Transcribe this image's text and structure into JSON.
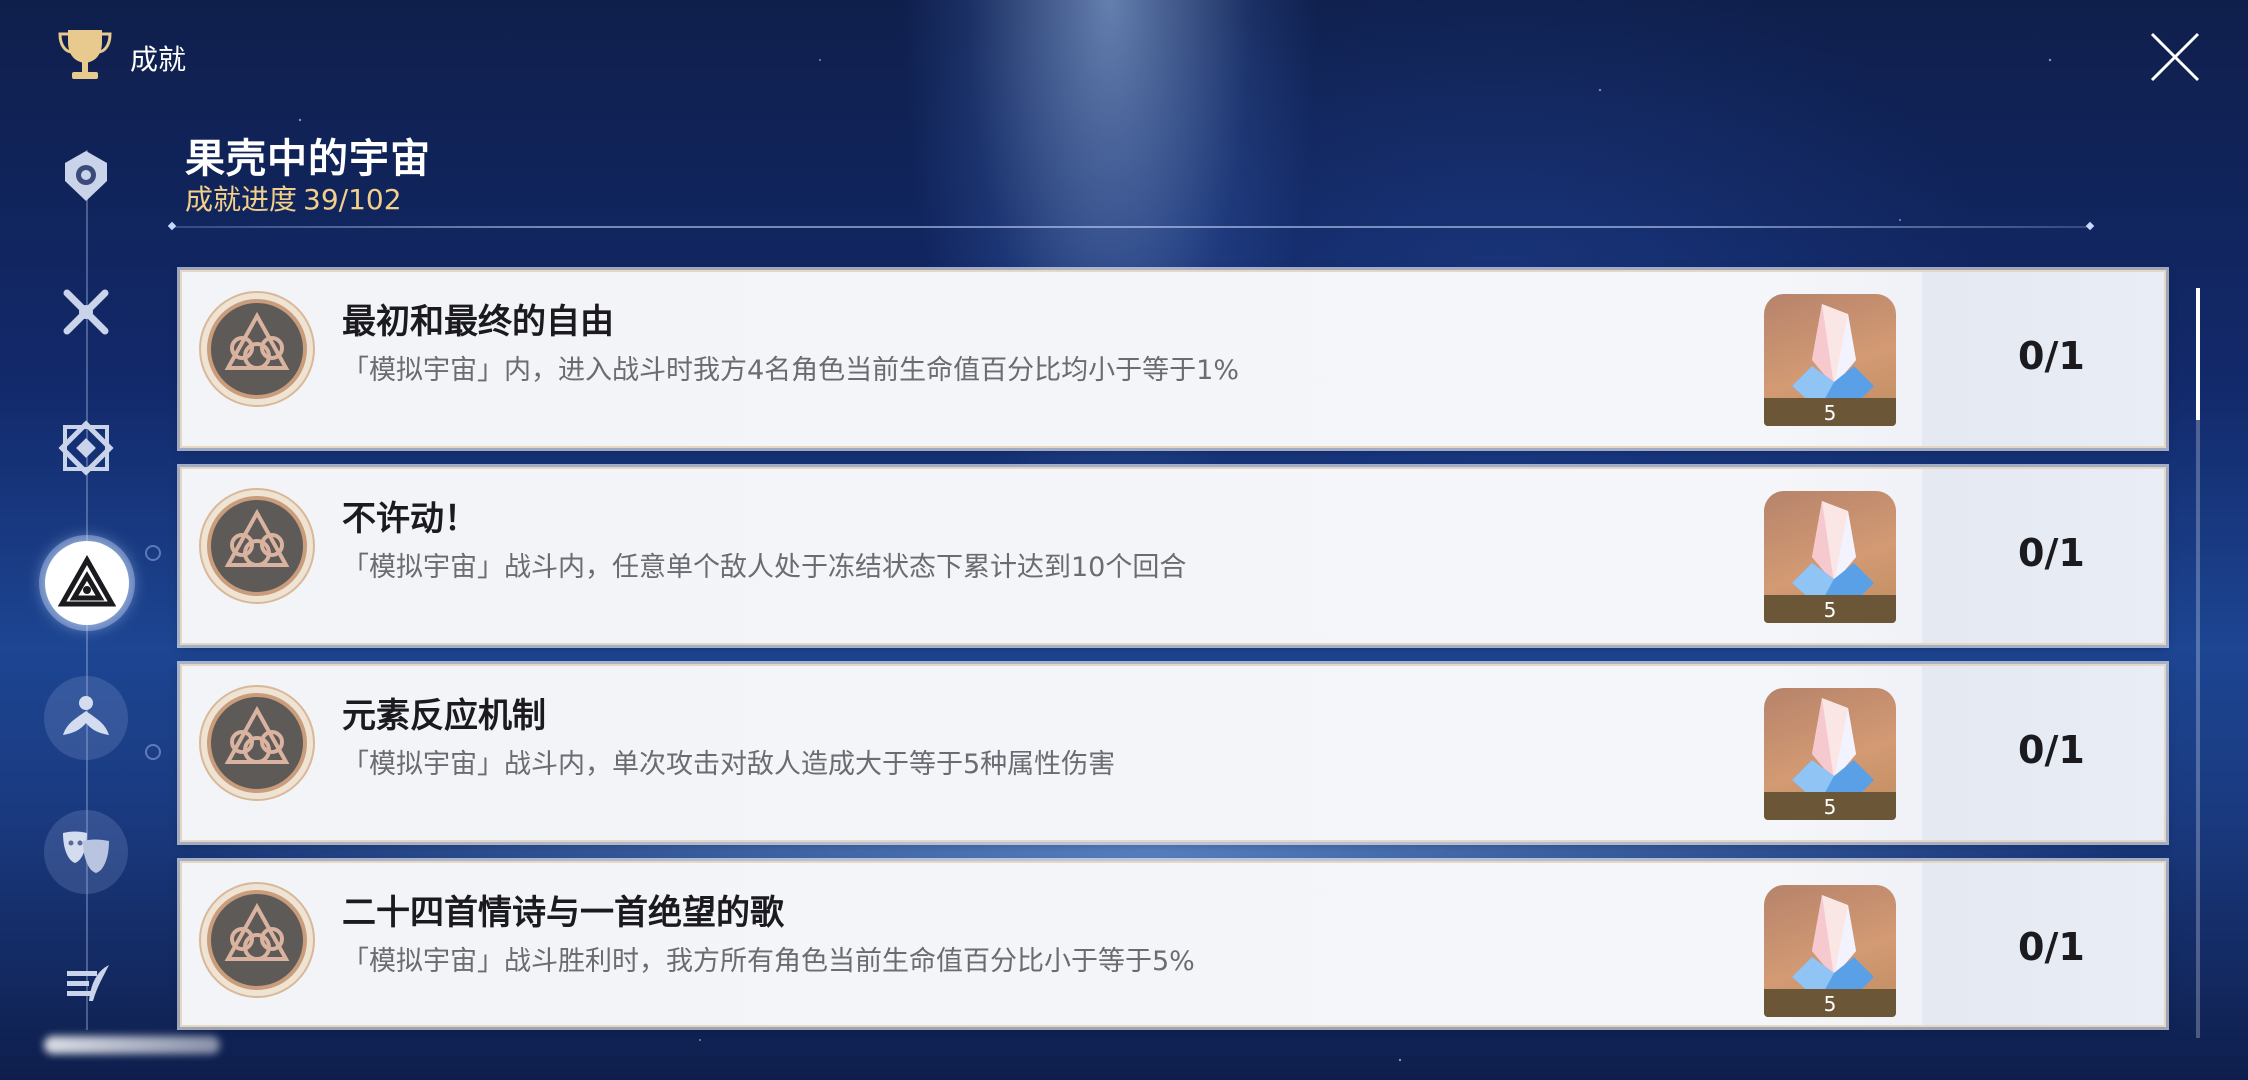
{
  "header": {
    "title": "成就"
  },
  "category": {
    "title": "果壳中的宇宙",
    "progress_label": "成就进度",
    "progress_value": "39/102"
  },
  "sidebar": {
    "items": [
      {
        "icon": "helmet-emblem-icon",
        "active": false
      },
      {
        "icon": "crossed-swords-icon",
        "active": false
      },
      {
        "icon": "diamond-crest-icon",
        "active": false
      },
      {
        "icon": "triangle-knot-icon",
        "active": true
      },
      {
        "icon": "lotus-figure-icon",
        "active": false
      },
      {
        "icon": "theater-masks-icon",
        "active": false
      },
      {
        "icon": "quill-icon",
        "active": false
      }
    ]
  },
  "achievements": [
    {
      "title": "最初和最终的自由",
      "description": "「模拟宇宙」内，进入战斗时我方4名角色当前生命值百分比均小于等于1%",
      "reward_qty": "5",
      "progress": "0/1"
    },
    {
      "title": "不许动！",
      "description": "「模拟宇宙」战斗内，任意单个敌人处于冻结状态下累计达到10个回合",
      "reward_qty": "5",
      "progress": "0/1"
    },
    {
      "title": "元素反应机制",
      "description": "「模拟宇宙」战斗内，单次攻击对敌人造成大于等于5种属性伤害",
      "reward_qty": "5",
      "progress": "0/1"
    },
    {
      "title": "二十四首情诗与一首绝望的歌",
      "description": "「模拟宇宙」战斗胜利时，我方所有角色当前生命值百分比小于等于5%",
      "reward_qty": "5",
      "progress": "0/1"
    }
  ],
  "colors": {
    "accent_gold": "#f3d08a",
    "card_border": "#e6d7c2",
    "reward_bg": "#c08d60"
  }
}
